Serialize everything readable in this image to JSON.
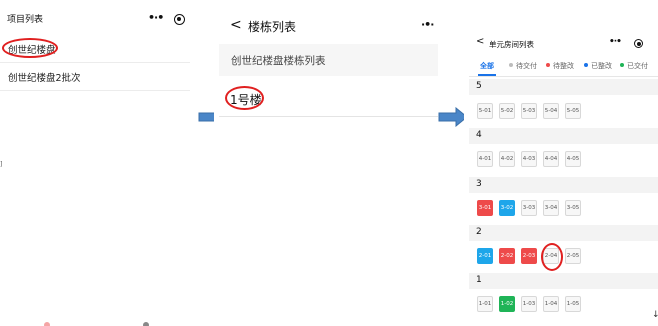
{
  "panel1": {
    "title": "项目列表",
    "projects": [
      "创世纪楼盘",
      "创世纪楼盘2批次"
    ],
    "tick": "]"
  },
  "panel2": {
    "back_icon": "chevron-left-icon",
    "title": "楼栋列表",
    "card": "创世纪楼盘楼栋列表",
    "building": "1号楼"
  },
  "panel3": {
    "back_icon": "chevron-left-icon",
    "title": "单元房间列表",
    "tabs": [
      {
        "label": "全部",
        "color": ""
      },
      {
        "label": "待交付",
        "color": "#bdbdbd"
      },
      {
        "label": "待整改",
        "color": "#ee4a4a"
      },
      {
        "label": "已整改",
        "color": "#1a73e8"
      },
      {
        "label": "已交付",
        "color": "#1fb457"
      }
    ],
    "floors": [
      {
        "label": "5",
        "units": [
          {
            "name": "5-01",
            "status": "pending"
          },
          {
            "name": "5-02",
            "status": "pending"
          },
          {
            "name": "5-03",
            "status": "pending"
          },
          {
            "name": "5-04",
            "status": "pending"
          },
          {
            "name": "5-05",
            "status": "pending"
          }
        ]
      },
      {
        "label": "4",
        "units": [
          {
            "name": "4-01",
            "status": "pending"
          },
          {
            "name": "4-02",
            "status": "pending"
          },
          {
            "name": "4-03",
            "status": "pending"
          },
          {
            "name": "4-04",
            "status": "pending"
          },
          {
            "name": "4-05",
            "status": "pending"
          }
        ]
      },
      {
        "label": "3",
        "units": [
          {
            "name": "3-01",
            "status": "rectify"
          },
          {
            "name": "3-02",
            "status": "rectified"
          },
          {
            "name": "3-03",
            "status": "pending"
          },
          {
            "name": "3-04",
            "status": "pending"
          },
          {
            "name": "3-05",
            "status": "pending"
          }
        ]
      },
      {
        "label": "2",
        "units": [
          {
            "name": "2-01",
            "status": "rectified"
          },
          {
            "name": "2-02",
            "status": "rectify"
          },
          {
            "name": "2-03",
            "status": "rectify"
          },
          {
            "name": "2-04",
            "status": "pending"
          },
          {
            "name": "2-05",
            "status": "pending"
          }
        ]
      },
      {
        "label": "1",
        "units": [
          {
            "name": "1-01",
            "status": "pending"
          },
          {
            "name": "1-02",
            "status": "delivered"
          },
          {
            "name": "1-03",
            "status": "pending"
          },
          {
            "name": "1-04",
            "status": "pending"
          },
          {
            "name": "1-05",
            "status": "pending"
          }
        ]
      }
    ],
    "corner_mark": "↓"
  },
  "colors": {
    "highlight_ring": "#e02020",
    "flow_arrow": "#4a86c8",
    "accent": "#1a73e8"
  }
}
